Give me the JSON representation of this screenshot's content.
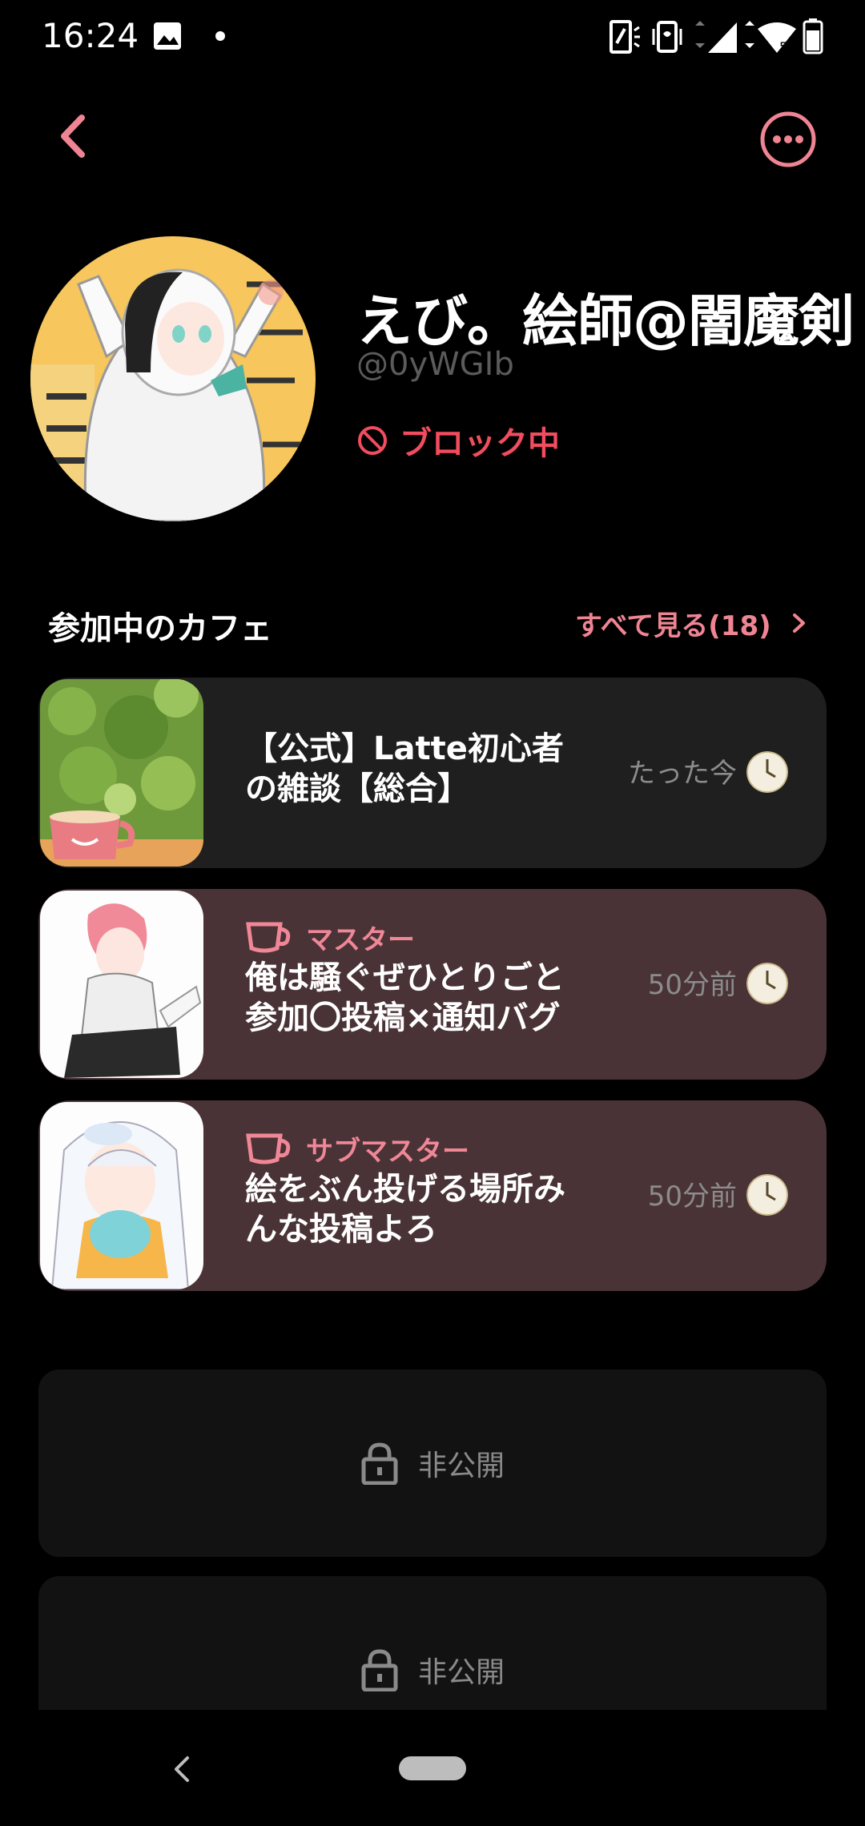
{
  "status_bar": {
    "time": "16:24",
    "icons": [
      "image-icon",
      "dot-icon",
      "nfc-icon",
      "vibrate-icon",
      "signal-icon",
      "wifi-icon",
      "battery-icon"
    ],
    "wifi_label": "5"
  },
  "header": {
    "back_icon": "chevron-left-icon",
    "more_icon": "more-horizontal-icon"
  },
  "profile": {
    "display_name": "えび。絵師@闇魔剣",
    "handle": "@0yWGIb",
    "block_status": "ブロック中"
  },
  "cafes_section": {
    "title": "参加中のカフェ",
    "see_all_label": "すべて見る(18)",
    "items": [
      {
        "name_line1": "【公式】Latte初心者",
        "name_line2": "の雑談【総合】",
        "role": "",
        "time": "たった今"
      },
      {
        "name_line1": "俺は騒ぐぜひとりごと",
        "name_line2": "参加〇投稿×通知バグ",
        "role": "マスター",
        "time": "50分前"
      },
      {
        "name_line1": "絵をぶん投げる場所み",
        "name_line2": "んな投稿よろ",
        "role": "サブマスター",
        "time": "50分前"
      }
    ],
    "private_items": [
      {
        "label": "非公開"
      },
      {
        "label": "非公開"
      }
    ]
  },
  "colors": {
    "accent_pink": "#ef8493",
    "block_red": "#f24c5e",
    "card_plain": "#1f1f1f",
    "card_role": "#4a3336",
    "private_card": "#121212"
  }
}
